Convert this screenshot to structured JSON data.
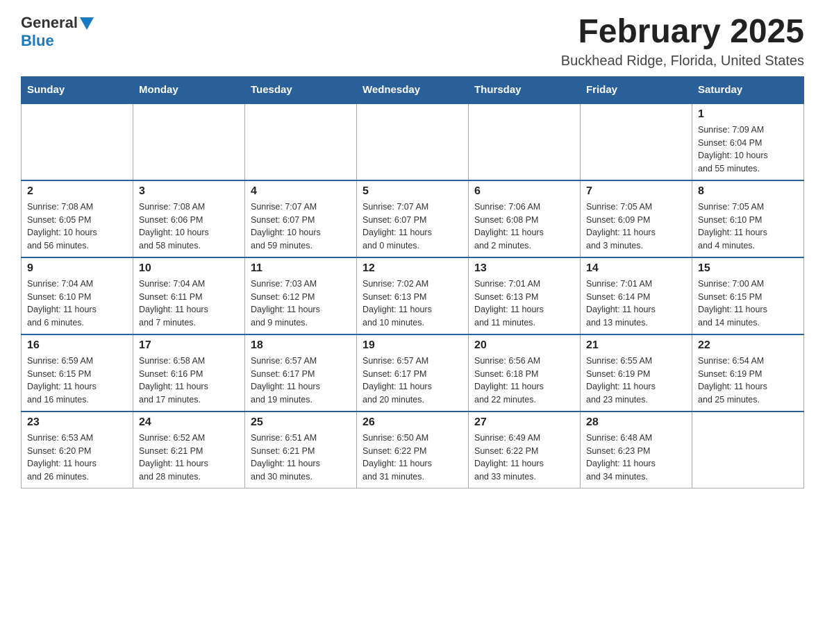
{
  "header": {
    "logo": {
      "general": "General",
      "blue": "Blue"
    },
    "month_title": "February 2025",
    "location": "Buckhead Ridge, Florida, United States"
  },
  "days_of_week": [
    "Sunday",
    "Monday",
    "Tuesday",
    "Wednesday",
    "Thursday",
    "Friday",
    "Saturday"
  ],
  "weeks": [
    {
      "days": [
        {
          "num": "",
          "info": "",
          "empty": true
        },
        {
          "num": "",
          "info": "",
          "empty": true
        },
        {
          "num": "",
          "info": "",
          "empty": true
        },
        {
          "num": "",
          "info": "",
          "empty": true
        },
        {
          "num": "",
          "info": "",
          "empty": true
        },
        {
          "num": "",
          "info": "",
          "empty": true
        },
        {
          "num": "1",
          "info": "Sunrise: 7:09 AM\nSunset: 6:04 PM\nDaylight: 10 hours\nand 55 minutes."
        }
      ]
    },
    {
      "days": [
        {
          "num": "2",
          "info": "Sunrise: 7:08 AM\nSunset: 6:05 PM\nDaylight: 10 hours\nand 56 minutes."
        },
        {
          "num": "3",
          "info": "Sunrise: 7:08 AM\nSunset: 6:06 PM\nDaylight: 10 hours\nand 58 minutes."
        },
        {
          "num": "4",
          "info": "Sunrise: 7:07 AM\nSunset: 6:07 PM\nDaylight: 10 hours\nand 59 minutes."
        },
        {
          "num": "5",
          "info": "Sunrise: 7:07 AM\nSunset: 6:07 PM\nDaylight: 11 hours\nand 0 minutes."
        },
        {
          "num": "6",
          "info": "Sunrise: 7:06 AM\nSunset: 6:08 PM\nDaylight: 11 hours\nand 2 minutes."
        },
        {
          "num": "7",
          "info": "Sunrise: 7:05 AM\nSunset: 6:09 PM\nDaylight: 11 hours\nand 3 minutes."
        },
        {
          "num": "8",
          "info": "Sunrise: 7:05 AM\nSunset: 6:10 PM\nDaylight: 11 hours\nand 4 minutes."
        }
      ]
    },
    {
      "days": [
        {
          "num": "9",
          "info": "Sunrise: 7:04 AM\nSunset: 6:10 PM\nDaylight: 11 hours\nand 6 minutes."
        },
        {
          "num": "10",
          "info": "Sunrise: 7:04 AM\nSunset: 6:11 PM\nDaylight: 11 hours\nand 7 minutes."
        },
        {
          "num": "11",
          "info": "Sunrise: 7:03 AM\nSunset: 6:12 PM\nDaylight: 11 hours\nand 9 minutes."
        },
        {
          "num": "12",
          "info": "Sunrise: 7:02 AM\nSunset: 6:13 PM\nDaylight: 11 hours\nand 10 minutes."
        },
        {
          "num": "13",
          "info": "Sunrise: 7:01 AM\nSunset: 6:13 PM\nDaylight: 11 hours\nand 11 minutes."
        },
        {
          "num": "14",
          "info": "Sunrise: 7:01 AM\nSunset: 6:14 PM\nDaylight: 11 hours\nand 13 minutes."
        },
        {
          "num": "15",
          "info": "Sunrise: 7:00 AM\nSunset: 6:15 PM\nDaylight: 11 hours\nand 14 minutes."
        }
      ]
    },
    {
      "days": [
        {
          "num": "16",
          "info": "Sunrise: 6:59 AM\nSunset: 6:15 PM\nDaylight: 11 hours\nand 16 minutes."
        },
        {
          "num": "17",
          "info": "Sunrise: 6:58 AM\nSunset: 6:16 PM\nDaylight: 11 hours\nand 17 minutes."
        },
        {
          "num": "18",
          "info": "Sunrise: 6:57 AM\nSunset: 6:17 PM\nDaylight: 11 hours\nand 19 minutes."
        },
        {
          "num": "19",
          "info": "Sunrise: 6:57 AM\nSunset: 6:17 PM\nDaylight: 11 hours\nand 20 minutes."
        },
        {
          "num": "20",
          "info": "Sunrise: 6:56 AM\nSunset: 6:18 PM\nDaylight: 11 hours\nand 22 minutes."
        },
        {
          "num": "21",
          "info": "Sunrise: 6:55 AM\nSunset: 6:19 PM\nDaylight: 11 hours\nand 23 minutes."
        },
        {
          "num": "22",
          "info": "Sunrise: 6:54 AM\nSunset: 6:19 PM\nDaylight: 11 hours\nand 25 minutes."
        }
      ]
    },
    {
      "days": [
        {
          "num": "23",
          "info": "Sunrise: 6:53 AM\nSunset: 6:20 PM\nDaylight: 11 hours\nand 26 minutes."
        },
        {
          "num": "24",
          "info": "Sunrise: 6:52 AM\nSunset: 6:21 PM\nDaylight: 11 hours\nand 28 minutes."
        },
        {
          "num": "25",
          "info": "Sunrise: 6:51 AM\nSunset: 6:21 PM\nDaylight: 11 hours\nand 30 minutes."
        },
        {
          "num": "26",
          "info": "Sunrise: 6:50 AM\nSunset: 6:22 PM\nDaylight: 11 hours\nand 31 minutes."
        },
        {
          "num": "27",
          "info": "Sunrise: 6:49 AM\nSunset: 6:22 PM\nDaylight: 11 hours\nand 33 minutes."
        },
        {
          "num": "28",
          "info": "Sunrise: 6:48 AM\nSunset: 6:23 PM\nDaylight: 11 hours\nand 34 minutes."
        },
        {
          "num": "",
          "info": "",
          "empty": true
        }
      ]
    }
  ]
}
